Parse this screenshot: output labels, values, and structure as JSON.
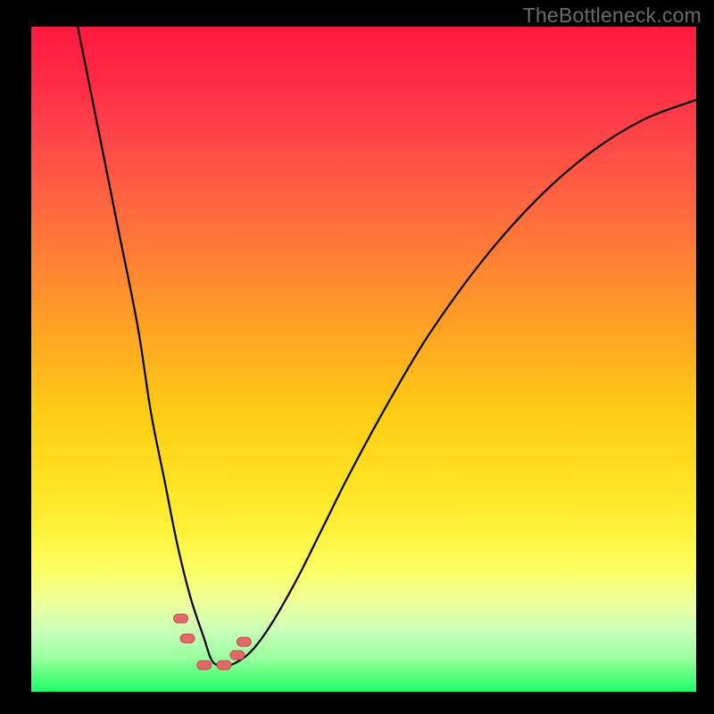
{
  "watermark": "TheBottleneck.com",
  "colors": {
    "frame": "#000000",
    "curve": "#000000",
    "marker_fill": "#e06a6a",
    "marker_stroke": "#c94f4f",
    "gradient_top": "#ff1a3f",
    "gradient_bottom": "#1fff6a"
  },
  "chart_data": {
    "type": "line",
    "title": "",
    "xlabel": "",
    "ylabel": "",
    "xlim": [
      0,
      100
    ],
    "ylim": [
      0,
      100
    ],
    "grid": false,
    "legend": false,
    "series": [
      {
        "name": "bottleneck-curve",
        "x": [
          7,
          10,
          13,
          16,
          18,
          20,
          22,
          24,
          26,
          27,
          28,
          30,
          33,
          36,
          40,
          44,
          48,
          54,
          60,
          68,
          76,
          84,
          92,
          100
        ],
        "y": [
          100,
          85,
          70,
          55,
          42,
          32,
          22,
          14,
          8,
          5,
          4,
          4,
          6,
          10,
          17,
          25,
          33,
          44,
          54,
          65,
          74,
          81,
          86,
          89
        ]
      }
    ],
    "markers": [
      {
        "x": 22.5,
        "y": 11,
        "r": 2.0
      },
      {
        "x": 23.5,
        "y": 8,
        "r": 2.0
      },
      {
        "x": 26,
        "y": 4,
        "r": 2.0
      },
      {
        "x": 29,
        "y": 4,
        "r": 2.0
      },
      {
        "x": 31,
        "y": 5.5,
        "r": 2.0
      },
      {
        "x": 32,
        "y": 7.5,
        "r": 2.0
      }
    ]
  }
}
